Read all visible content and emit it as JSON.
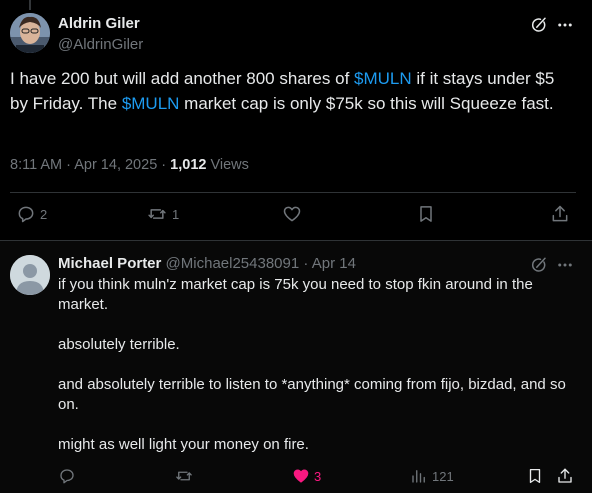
{
  "main_post": {
    "author_name": "Aldrin Giler",
    "author_handle": "@AldrinGiler",
    "text_parts": [
      {
        "text": "I have 200 but will add another 800 shares of ",
        "cashtag": false
      },
      {
        "text": "$MULN",
        "cashtag": true
      },
      {
        "text": " if it stays under $5 by Friday. The ",
        "cashtag": false
      },
      {
        "text": "$MULN",
        "cashtag": true
      },
      {
        "text": " market cap is only $75k so this will Squeeze fast.",
        "cashtag": false
      }
    ],
    "time": "8:11 AM",
    "date": "Apr 14, 2025",
    "views_count": "1,012",
    "views_label": "Views",
    "actions": {
      "replies": "2",
      "reposts": "1"
    }
  },
  "reply": {
    "author_name": "Michael Porter",
    "author_handle": "@Michael25438091",
    "separator": "·",
    "date": "Apr 14",
    "paragraphs": [
      "if you think muln'z market cap is 75k you need to stop fkin around in the market.",
      "absolutely terrible.",
      "and absolutely terrible to  listen to *anything* coming from fijo, bizdad, and so on.",
      "might as well light your money on fire."
    ],
    "actions": {
      "likes": "3",
      "views": "121"
    }
  },
  "colors": {
    "background": "#000000",
    "text": "#e7e9ea",
    "muted": "#71767b",
    "accent": "#1d9bf0",
    "like": "#f91880",
    "divider": "#2f3336"
  },
  "icons": [
    "grok-icon",
    "more-icon",
    "reply-icon",
    "repost-icon",
    "like-icon",
    "bookmark-icon",
    "share-icon",
    "views-icon"
  ]
}
